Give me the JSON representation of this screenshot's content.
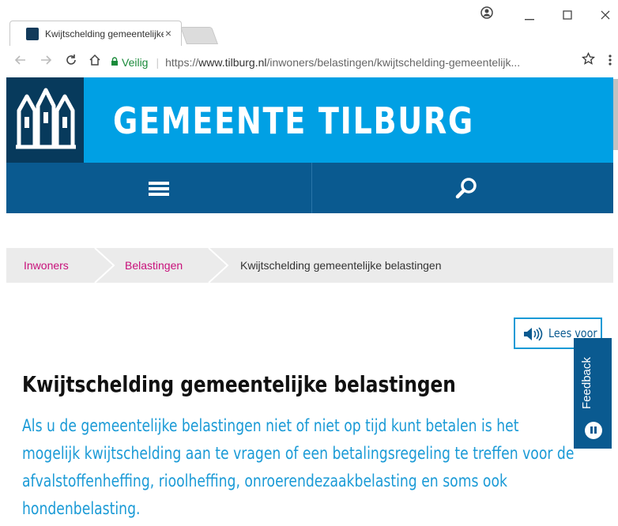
{
  "browser": {
    "tab_title": "Kwijtschelding gemeentelijke belastingen",
    "tab_close": "×",
    "secure_label": "Veilig",
    "url_scheme": "https://",
    "url_host": "www.tilburg.nl",
    "url_path": "/inwoners/belastingen/kwijtschelding-gemeentelijk...",
    "icons": [
      "account-icon",
      "minimize-icon",
      "maximize-icon",
      "close-window-icon",
      "back-icon",
      "forward-icon",
      "reload-icon",
      "home-icon",
      "lock-icon",
      "star-icon",
      "menu-icon"
    ]
  },
  "site": {
    "title": "GEMEENTE TILBURG",
    "brand_color": "#00a0e4",
    "dark_color": "#0a5a90",
    "logo_color": "#073a5c"
  },
  "breadcrumb": {
    "items": [
      "Inwoners",
      "Belastingen"
    ],
    "current": "Kwijtschelding gemeentelijke belastingen",
    "link_color": "#c8107a"
  },
  "content": {
    "lees_voor": "Lees voor",
    "feedback": "Feedback",
    "heading": "Kwijtschelding gemeentelijke belastingen",
    "intro": "Als u de gemeentelijke belastingen niet of niet op tijd kunt betalen is het mogelijk kwijtschelding aan te vragen of een betalingsregeling te treffen voor de afvalstoffenheffing, rioolheffing, onroerendezaakbelasting en soms ook hondenbelasting."
  }
}
